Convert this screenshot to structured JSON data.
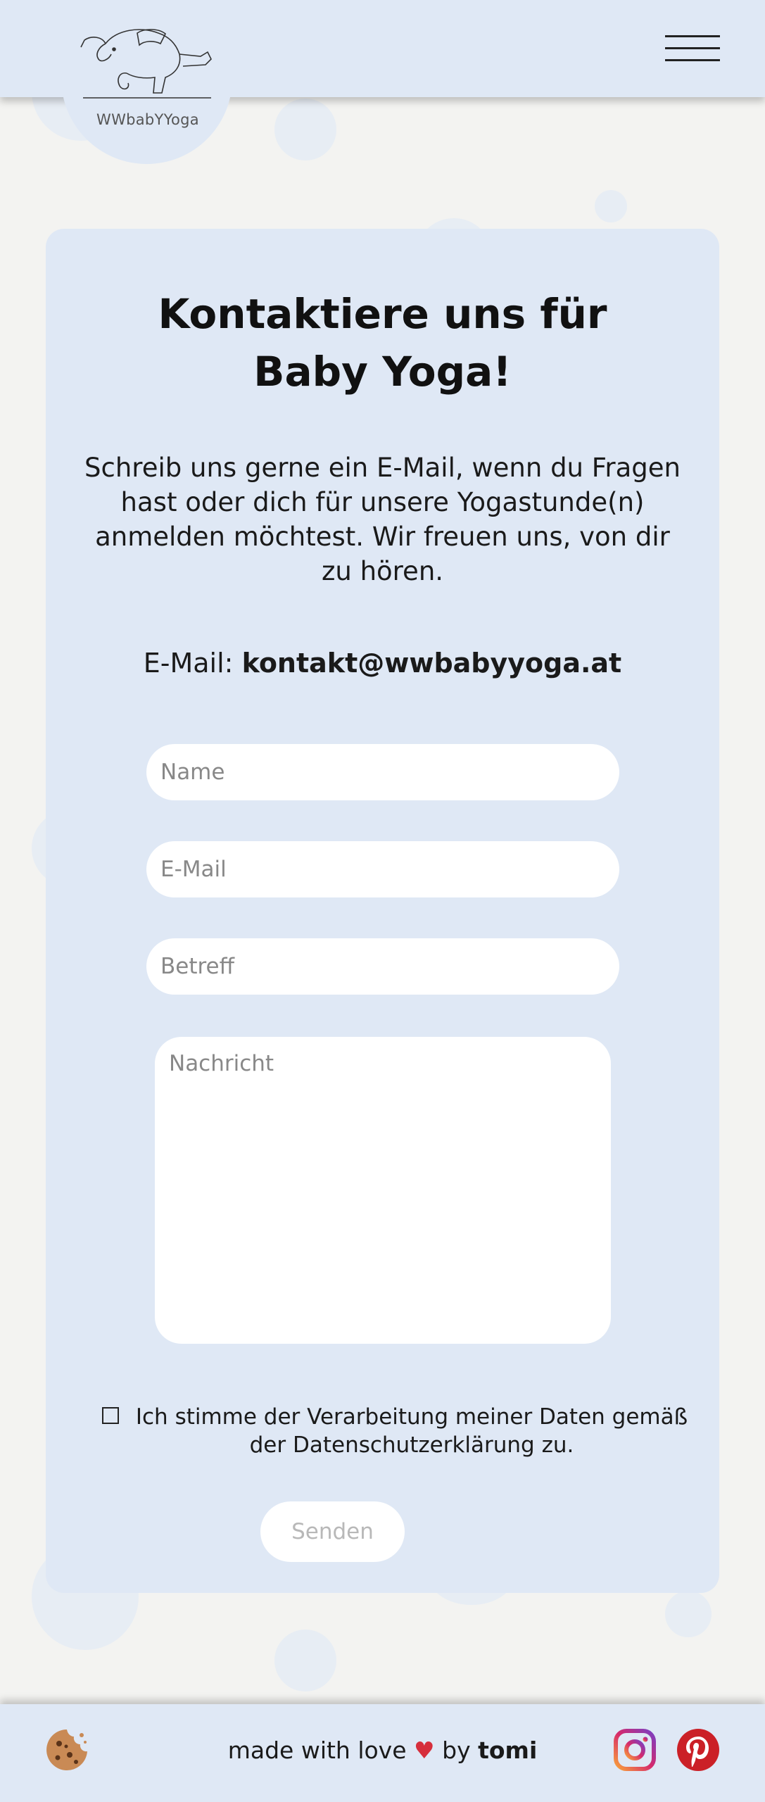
{
  "header": {
    "logo_text": "WWbabYYoga",
    "menu_icon": "hamburger-menu-icon"
  },
  "contact": {
    "title": "Kontaktiere uns für Baby Yoga!",
    "intro": "Schreib uns gerne ein E-Mail, wenn du Fragen hast oder dich für unsere Yogastunde(n) anmelden möchtest. Wir freuen uns, von dir zu hören.",
    "email_label": "E-Mail:",
    "email_address": "kontakt@wwbabyyoga.at"
  },
  "form": {
    "name_placeholder": "Name",
    "email_placeholder": "E-Mail",
    "subject_placeholder": "Betreff",
    "message_placeholder": "Nachricht",
    "consent_text": "Ich stimme der Verarbeitung meiner Daten gemäß der Datenschutzerklärung zu.",
    "consent_checked": false,
    "send_label": "Senden"
  },
  "footer": {
    "made_with": "made with love",
    "heart": "♥",
    "by": "by",
    "author": "tomi",
    "icons": [
      "cookie-icon",
      "instagram-icon",
      "pinterest-icon"
    ]
  },
  "colors": {
    "panel": "#dfe8f5",
    "background": "#f3f3f1",
    "heart": "#d62e3c",
    "pinterest": "#cb2027"
  }
}
